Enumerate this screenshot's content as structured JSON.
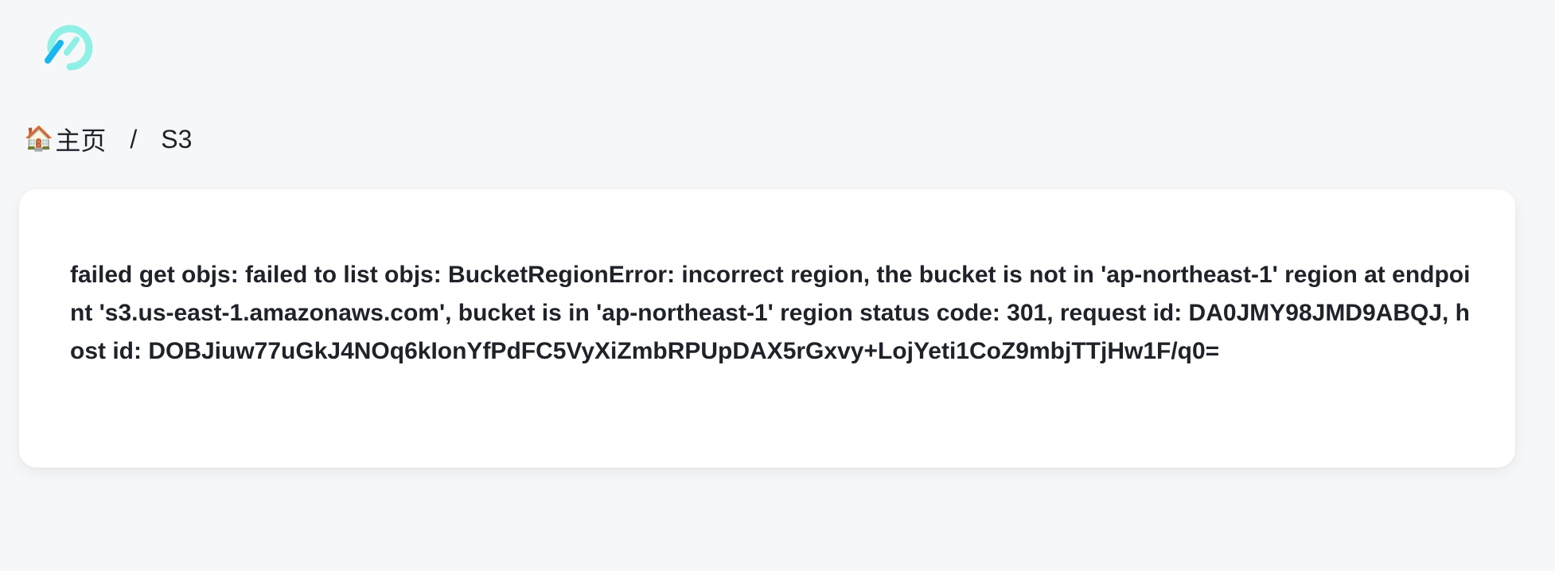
{
  "logo": {
    "icon": "app-logo-icon",
    "colors": {
      "ring": "#8ff0e6",
      "stroke": "#18b7f0"
    }
  },
  "breadcrumb": {
    "items": [
      {
        "icon": "🏠",
        "label": "主页"
      },
      {
        "label": "S3"
      }
    ],
    "separator": "/"
  },
  "error": {
    "message": "failed get objs: failed to list objs: BucketRegionError: incorrect region, the bucket is not in 'ap-northeast-1' region at endpoint 's3.us-east-1.amazonaws.com', bucket is in 'ap-northeast-1' region status code: 301, request id: DA0JMY98JMD9ABQJ, host id: DOBJiuw77uGkJ4NOq6kIonYfPdFC5VyXiZmbRPUpDAX5rGxvy+LojYeti1CoZ9mbjTTjHw1F/q0="
  }
}
